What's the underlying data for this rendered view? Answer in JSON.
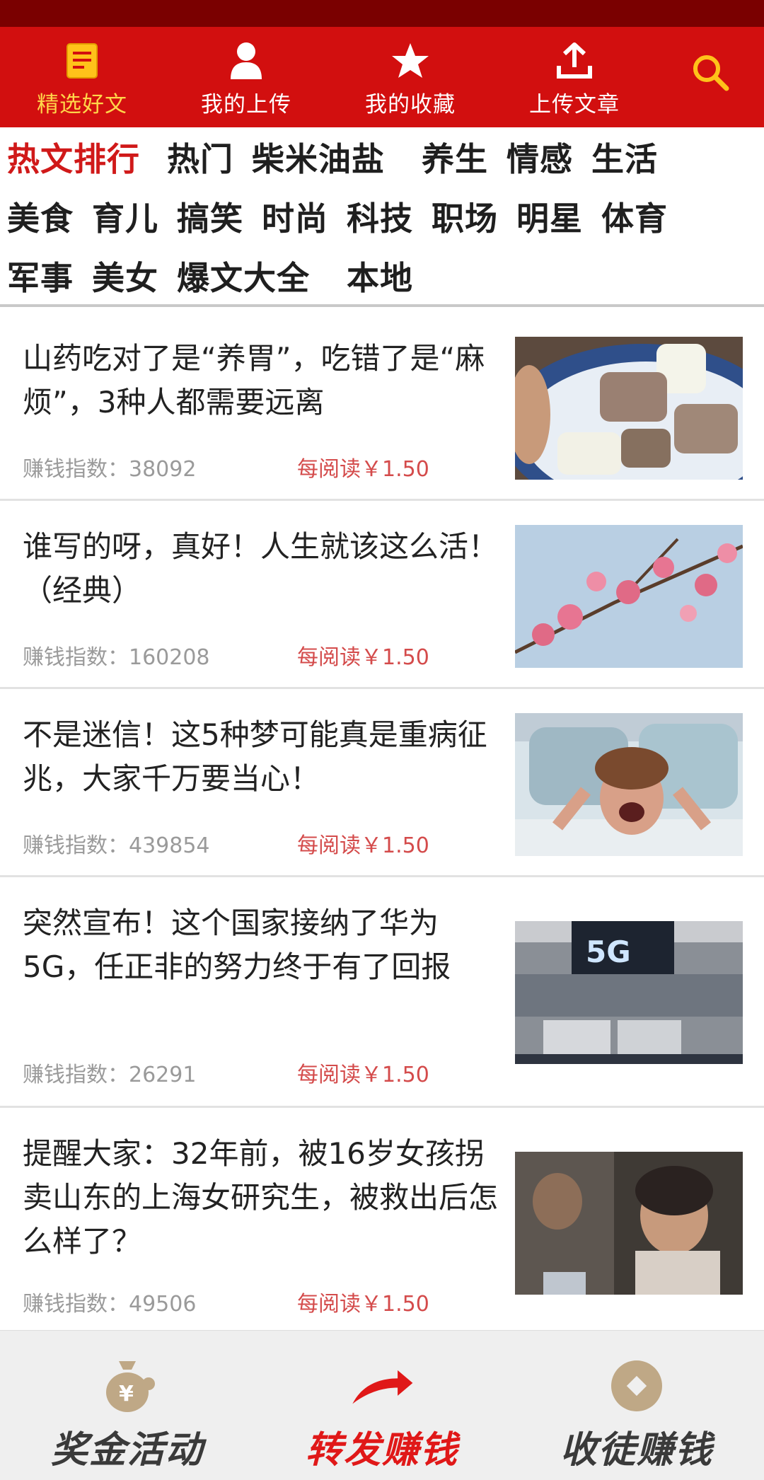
{
  "topnav": {
    "items": [
      {
        "label": "精选好文",
        "icon": "document-icon",
        "active": true
      },
      {
        "label": "我的上传",
        "icon": "user-icon",
        "active": false
      },
      {
        "label": "我的收藏",
        "icon": "star-icon",
        "active": false
      },
      {
        "label": "上传文章",
        "icon": "upload-icon",
        "active": false
      }
    ],
    "search_icon": "search-icon"
  },
  "categories": {
    "rows": [
      [
        "热文排行",
        "热门",
        "柴米油盐",
        "养生",
        "情感",
        "生活"
      ],
      [
        "美食",
        "育儿",
        "搞笑",
        "时尚",
        "科技",
        "职场",
        "明星",
        "体育"
      ],
      [
        "军事",
        "美女",
        "爆文大全",
        "本地"
      ]
    ],
    "active": "热文排行"
  },
  "articles": [
    {
      "title": "山药吃对了是“养胃”，吃错了是“麻烦”，3种人都需要远离",
      "index_label": "赚钱指数：38092",
      "price": "每阅读￥1.50"
    },
    {
      "title": "谁写的呀，真好！人生就该这么活！（经典）",
      "index_label": "赚钱指数：160208",
      "price": "每阅读￥1.50"
    },
    {
      "title": "不是迷信！这5种梦可能真是重病征兆，大家千万要当心！",
      "index_label": "赚钱指数：439854",
      "price": "每阅读￥1.50"
    },
    {
      "title": "突然宣布！这个国家接纳了华为5G，任正非的努力终于有了回报",
      "index_label": "赚钱指数：26291",
      "price": "每阅读￥1.50",
      "thumb_text": "5G"
    },
    {
      "title": "提醒大家：32年前，被16岁女孩拐卖山东的上海女研究生，被救出后怎么样了？",
      "index_label": "赚钱指数：49506",
      "price": "每阅读￥1.50"
    }
  ],
  "bottombar": {
    "items": [
      {
        "label": "奖金活动",
        "icon": "money-bag-icon"
      },
      {
        "label": "转发赚钱",
        "icon": "share-arrow-icon"
      },
      {
        "label": "收徒赚钱",
        "icon": "coin-icon"
      }
    ]
  },
  "colors": {
    "brand_red": "#d20f0f",
    "status_bar": "#7a0000",
    "active_yellow": "#ffd64a",
    "price_red": "#d44b4b"
  }
}
